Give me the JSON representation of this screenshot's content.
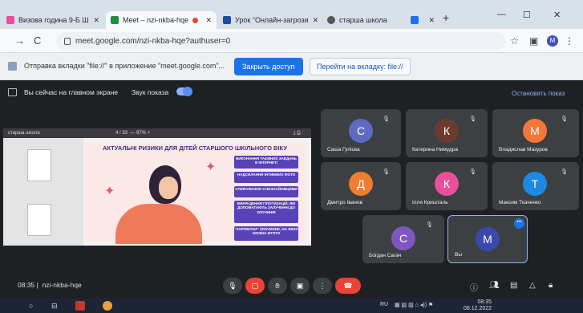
{
  "browser": {
    "tabs": [
      {
        "label": "Визова година 9-Б Ш",
        "color": "#e94f9b"
      },
      {
        "label": "Meet – nzi-nkba-hqe",
        "color": "#1e8e3e",
        "active": true
      },
      {
        "label": "Урок \"Онлайн-загрози",
        "color": "#174ea6"
      },
      {
        "label": "старша школа",
        "color": "#555555"
      },
      {
        "label": "",
        "color": "#1a73e8"
      }
    ],
    "url": "meet.google.com/nzi-nkba-hqe?authuser=0",
    "profile_initial": "M"
  },
  "infobar": {
    "text": "Отправка вкладки \"file://\" в приложение \"meet.google.com\"...",
    "share_button": "Закрыть доступ",
    "switch_button": "Перейти на вкладку: file://"
  },
  "meet": {
    "presenting_text": "Вы сейчас на главном экране",
    "sound_label": "Звук показа",
    "stop_label": "Остановить показ",
    "meeting_time": "08:35",
    "meeting_code": "nzi-nkba-hqe"
  },
  "slide": {
    "doc_name": "старша школа",
    "page": "4 / 33",
    "zoom": "97%",
    "title": "АКТУАЛЬНІ РИЗИКИ ДЛЯ ДІТЕЙ СТАРШОГО ШКІЛЬНОГО ВІКУ",
    "risks": [
      "ВИКОНАННЯ ТАЄМНИХ ЗАВДАНЬ В ІНТЕРНЕТІ",
      "НАДСИЛАННЯ ІНТИМНИХ ФОТО",
      "СПІЛКУВАННЯ З НЕЗНАЙОМЦЯМИ",
      "ВИКРАДЕННЯ ГІПОТИЗАЦІЙ, ЯКІ ДОПОМАГАЮТЬ ЗАЛУЧЕННІ ДО ЗЛОЧИНІВ",
      "\"ЗАРОБІТКИ\" ЗЛОЧИННЕ, НА ЯКИХ МОЖНА ВТЯТИ"
    ]
  },
  "participants": [
    {
      "name": "Саша Гупієва",
      "initial": "С",
      "color": "#5c6bc0"
    },
    {
      "name": "Катерина Нимудра",
      "initial": "К",
      "color": "#6d3b2e"
    },
    {
      "name": "Владислав Мазуров",
      "initial": "М",
      "color": "#f4773a"
    },
    {
      "name": "Дмитро Іванов",
      "initial": "Д",
      "color": "#ef7c31"
    },
    {
      "name": "Ілля Кришталь",
      "initial": "К",
      "color": "#e94f9b"
    },
    {
      "name": "Максим Ткаченко",
      "initial": "Т",
      "color": "#1e88e5"
    },
    {
      "name": "Богдан Сагач",
      "initial": "С",
      "color": "#7e57c2"
    },
    {
      "name": "Вы",
      "initial": "М",
      "color": "#3949ab"
    }
  ],
  "taskbar": {
    "lang": "RU",
    "time": "08:35",
    "date": "08.12.2022"
  }
}
